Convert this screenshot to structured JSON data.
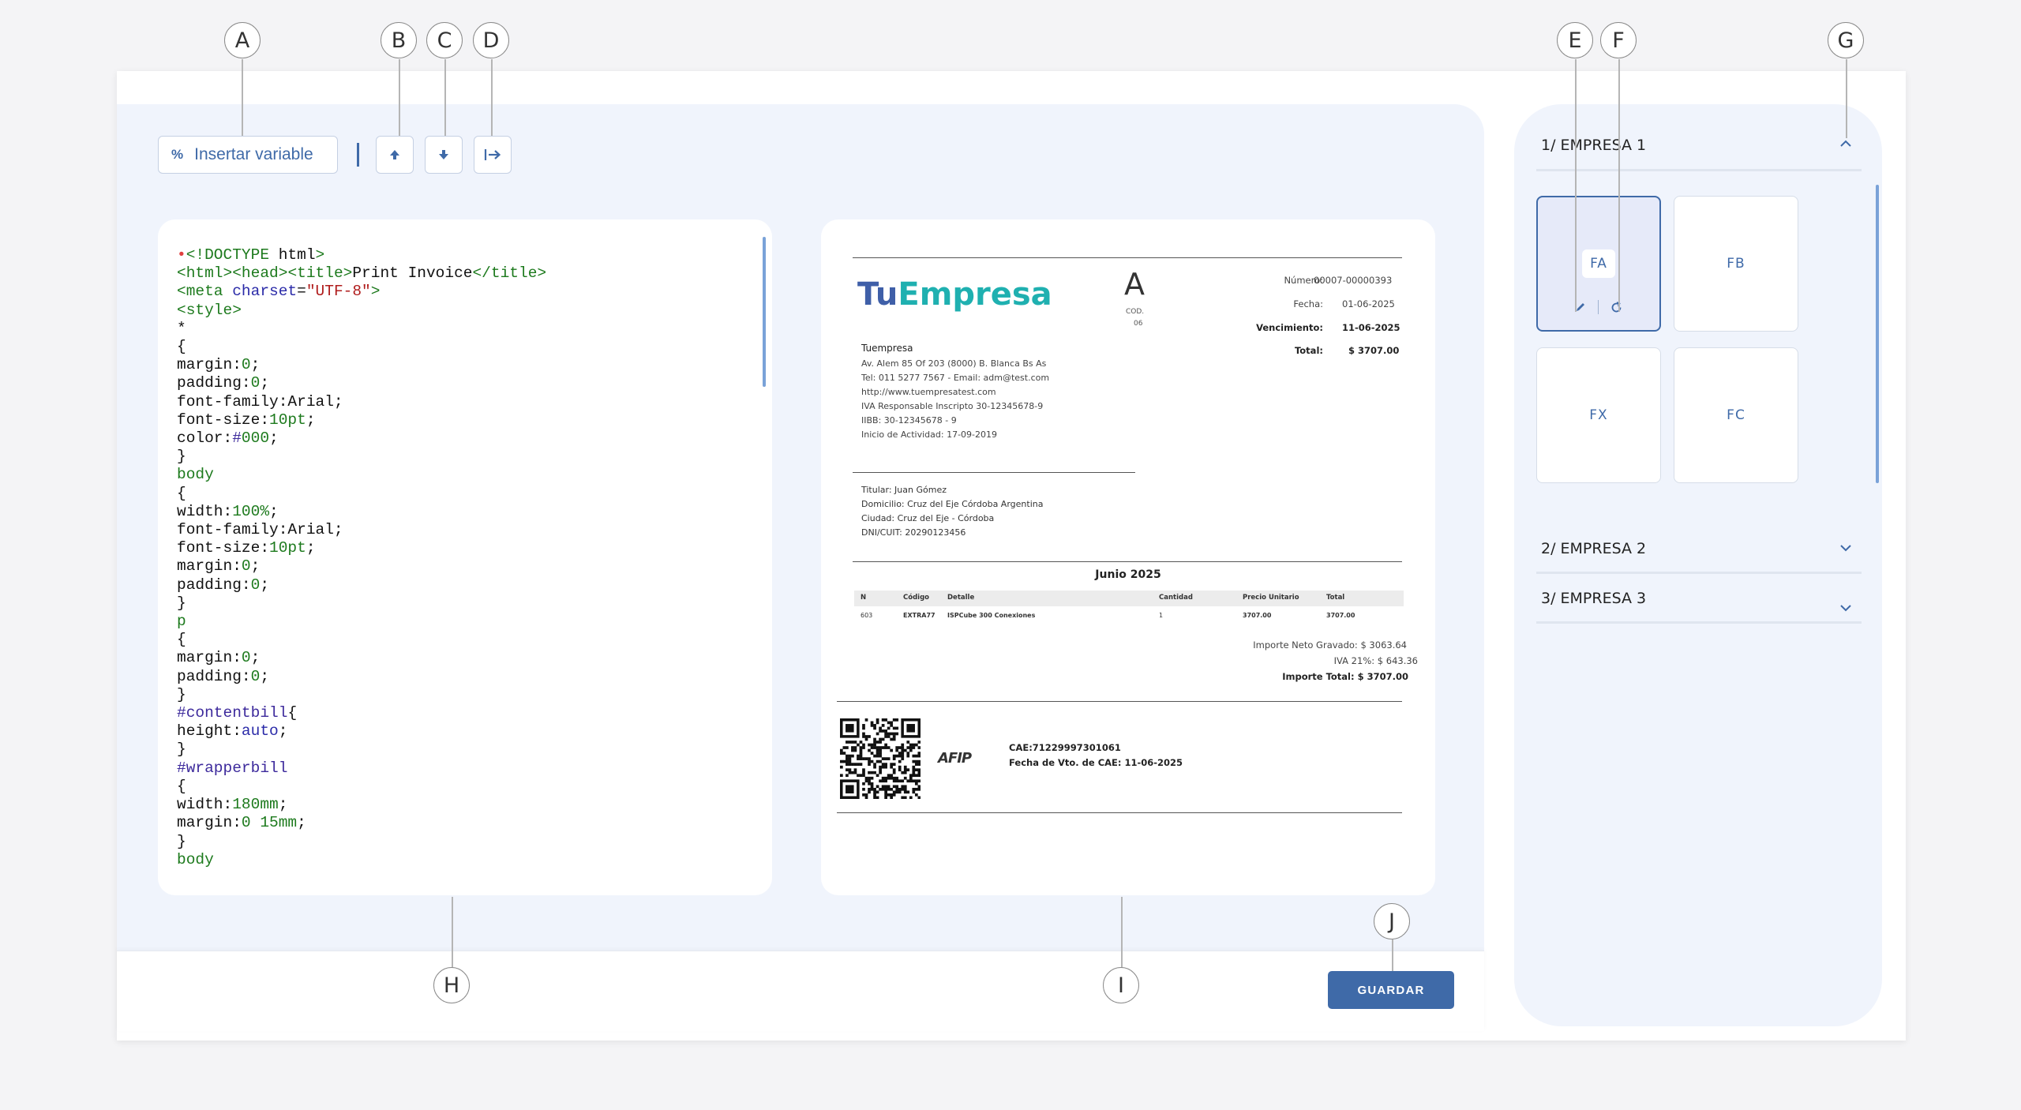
{
  "callouts": [
    "A",
    "B",
    "C",
    "D",
    "E",
    "F",
    "G",
    "H",
    "I",
    "J"
  ],
  "toolbar": {
    "insert_variable_icon": "%",
    "insert_variable_label": "Insertar variable",
    "move_up_icon": "arrow-up-icon",
    "move_down_icon": "arrow-down-icon",
    "indent_icon": "arrow-right-to-bar-icon"
  },
  "code_lines": [
    "<!DOCTYPE html>",
    "<html><head><title>Print Invoice</title>",
    "<meta charset=\"UTF-8\">",
    "<style>",
    "*",
    "{",
    "margin:0;",
    "padding:0;",
    "font-family:Arial;",
    "font-size:10pt;",
    "color:#000;",
    "}",
    "body",
    "{",
    "width:100%;",
    "font-family:Arial;",
    "font-size:10pt;",
    "margin:0;",
    "padding:0;",
    "}",
    "p",
    "{",
    "margin:0;",
    "padding:0;",
    "}",
    "#contentbill{",
    "height:auto;",
    "}",
    "#wrapperbill",
    "{",
    "width:180mm;",
    "margin:0 15mm;",
    "}",
    "body"
  ],
  "invoice": {
    "logo_part1": "Tu",
    "logo_part2": "Empresa",
    "letter": "A",
    "cod_label": "COD.",
    "cod_value": "06",
    "numero_label": "Número:",
    "numero_value": "00007-00000393",
    "fecha_label": "Fecha:",
    "fecha_value": "01-06-2025",
    "venc_label": "Vencimiento:",
    "venc_value": "11-06-2025",
    "total_label": "Total:",
    "total_value": "$ 3707.00",
    "company_name": "Tuempresa",
    "company_lines": [
      "Av. Alem 85 Of 203 (8000) B. Blanca Bs As",
      "Tel: 011 5277 7567 - Email: adm@test.com",
      "http://www.tuempresatest.com",
      "IVA Responsable Inscripto 30-12345678-9",
      "IIBB: 30-12345678 - 9",
      "Inicio de Actividad: 17-09-2019"
    ],
    "client_lines": [
      "Titular: Juan Gómez",
      "Domicilio: Cruz del Eje Córdoba Argentina",
      "Ciudad: Cruz del Eje - Córdoba",
      "DNI/CUIT: 20290123456"
    ],
    "period": "Junio 2025",
    "table_headers": [
      "N",
      "Código",
      "Detalle",
      "Cantidad",
      "Precio Unitario",
      "Total"
    ],
    "table_row": [
      "603",
      "EXTRA77",
      "ISPCube 300 Conexiones",
      "1",
      "3707.00",
      "3707.00"
    ],
    "neto": "Importe Neto Gravado: $ 3063.64",
    "iva": "IVA 21%: $ 643.36",
    "importe_total": "Importe Total: $ 3707.00",
    "afip": "AFIP",
    "cae": "CAE:71229997301061",
    "cae_vto": "Fecha de Vto. de CAE: 11-06-2025"
  },
  "footer": {
    "save_label": "GUARDAR"
  },
  "companies": [
    {
      "label": "1/ EMPRESA 1",
      "expanded": true
    },
    {
      "label": "2/ EMPRESA 2",
      "expanded": false
    },
    {
      "label": "3/ EMPRESA 3",
      "expanded": false
    }
  ],
  "templates": [
    {
      "label": "FA",
      "selected": true
    },
    {
      "label": "FB",
      "selected": false
    },
    {
      "label": "FX",
      "selected": false
    },
    {
      "label": "FC",
      "selected": false
    }
  ],
  "colors": {
    "accent": "#3f6aa8",
    "panel_bg": "#f0f4fc",
    "logo_blue": "#3f5fa8",
    "logo_teal": "#1fb0b0"
  }
}
